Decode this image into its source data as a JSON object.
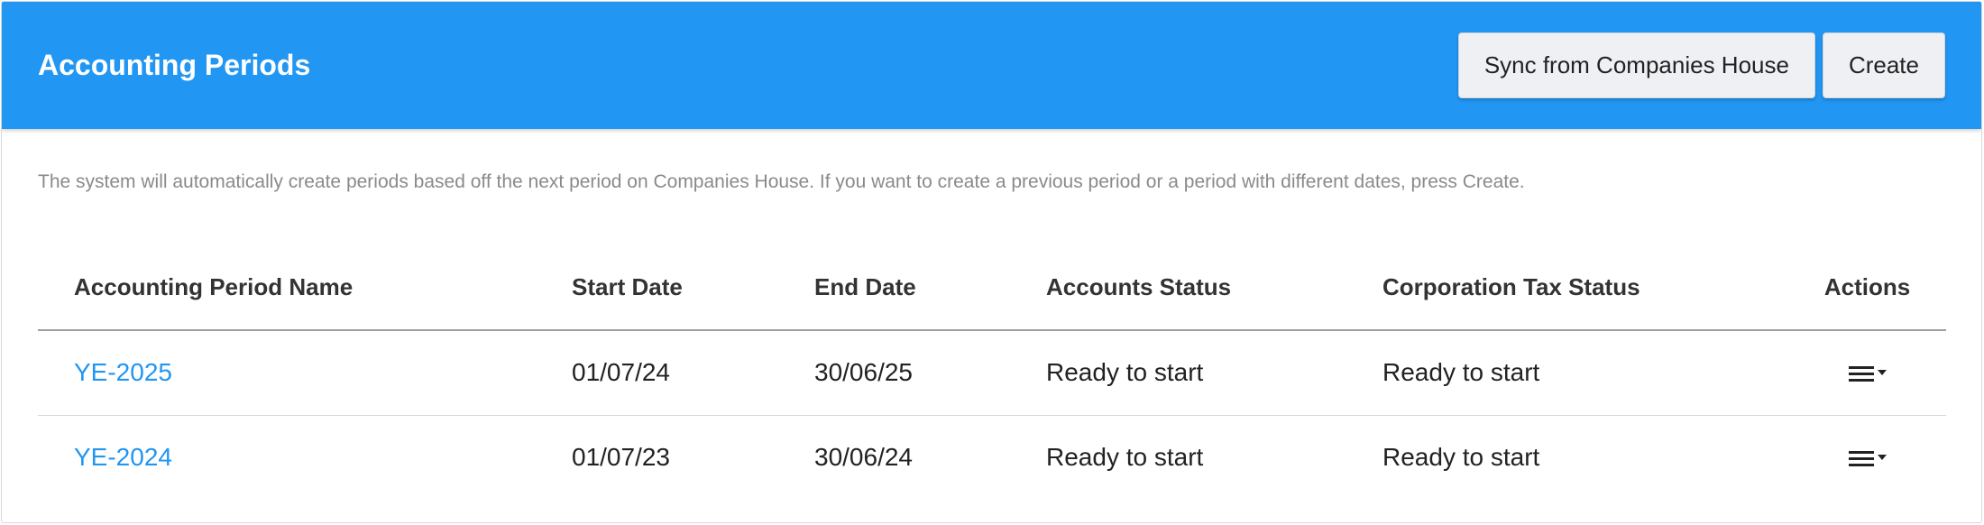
{
  "header": {
    "title": "Accounting Periods",
    "sync_button_label": "Sync from Companies House",
    "create_button_label": "Create"
  },
  "intro_text": "The system will automatically create periods based off the next period on Companies House. If you want to create a previous period or a period with different dates, press Create.",
  "table": {
    "columns": [
      "Accounting Period Name",
      "Start Date",
      "End Date",
      "Accounts Status",
      "Corporation Tax Status",
      "Actions"
    ],
    "rows": [
      {
        "name": "YE-2025",
        "start": "01/07/24",
        "end": "30/06/25",
        "accounts_status": "Ready to start",
        "ct_status": "Ready to start",
        "actions_icon": "menu-dropdown-icon"
      },
      {
        "name": "YE-2024",
        "start": "01/07/23",
        "end": "30/06/24",
        "accounts_status": "Ready to start",
        "ct_status": "Ready to start",
        "actions_icon": "menu-dropdown-icon"
      }
    ]
  },
  "colors": {
    "header_bg": "#2196f3",
    "link": "#2196f3"
  }
}
